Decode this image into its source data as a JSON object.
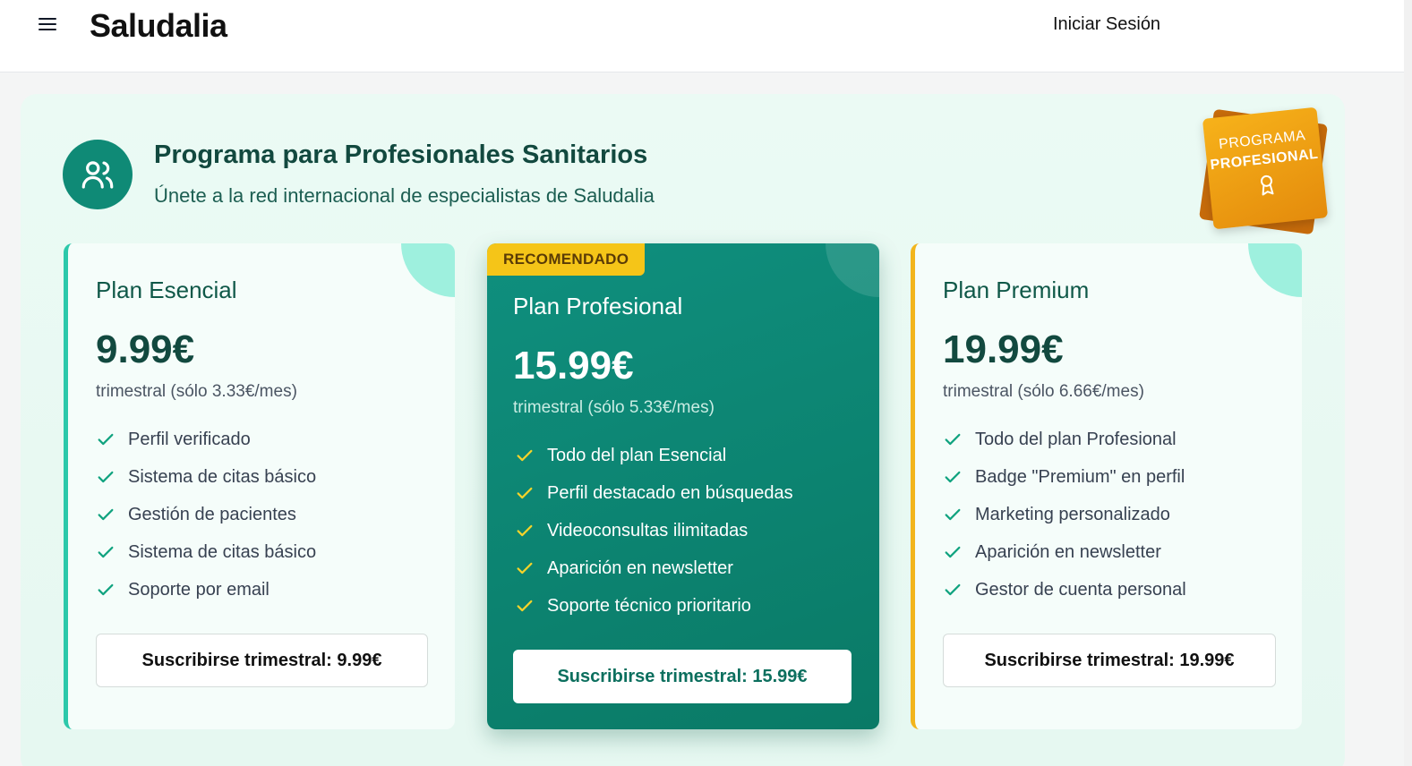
{
  "header": {
    "brand": "Saludalia",
    "login_label": "Iniciar Sesión"
  },
  "program": {
    "title": "Programa para Profesionales Sanitarios",
    "subtitle": "Únete a la red internacional de especialistas de Saludalia",
    "icon": "users-icon",
    "badge_line1": "PROGRAMA",
    "badge_line2": "PROFESIONAL",
    "badge_icon": "award-icon"
  },
  "colors": {
    "accent": "#0f8a76",
    "recommended": "#f5c518",
    "check_green": "#10a37f",
    "check_yellow": "#f5d32a"
  },
  "plans": [
    {
      "name": "Plan Esencial",
      "price": "9.99€",
      "period": "trimestral (sólo 3.33€/mes)",
      "features": [
        "Perfil verificado",
        "Sistema de citas básico",
        "Gestión de pacientes",
        "Sistema de citas básico",
        "Soporte por email"
      ],
      "button": "Suscribirse trimestral: 9.99€"
    },
    {
      "tag": "RECOMENDADO",
      "name": "Plan Profesional",
      "price": "15.99€",
      "period": "trimestral (sólo 5.33€/mes)",
      "features": [
        "Todo del plan Esencial",
        "Perfil destacado en búsquedas",
        "Videoconsultas ilimitadas",
        "Aparición en newsletter",
        "Soporte técnico prioritario"
      ],
      "button": "Suscribirse trimestral: 15.99€"
    },
    {
      "name": "Plan Premium",
      "price": "19.99€",
      "period": "trimestral (sólo 6.66€/mes)",
      "features": [
        "Todo del plan Profesional",
        "Badge \"Premium\" en perfil",
        "Marketing personalizado",
        "Aparición en newsletter",
        "Gestor de cuenta personal"
      ],
      "button": "Suscribirse trimestral: 19.99€"
    }
  ]
}
